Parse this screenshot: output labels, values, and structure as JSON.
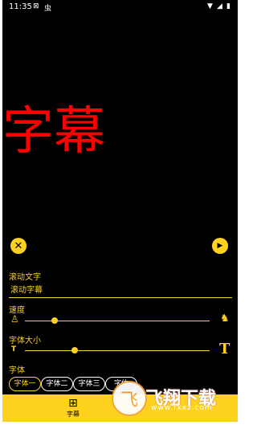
{
  "status": {
    "time": "11:35",
    "icons": [
      "notification-icon",
      "bug-icon",
      "wifi-icon",
      "signal-icon",
      "battery-icon"
    ]
  },
  "preview": {
    "text": "字幕",
    "color": "#ff0000"
  },
  "controls": {
    "text_label": "滚动文字",
    "text_value": "滚动字幕",
    "speed_label": "速度",
    "speed_value": 0.16,
    "size_label": "字体大小",
    "size_value": 0.27,
    "size_min_icon": "T",
    "size_max_icon": "T",
    "font_label": "字体",
    "fonts": [
      "字体一",
      "字体二",
      "字体三",
      "字体"
    ]
  },
  "tabbar": {
    "tab_label": "字幕",
    "tab_icon": "⊞"
  },
  "watermark": {
    "glyph": "飞",
    "text": "飞翔下载",
    "sub": "www.fxxz.com"
  },
  "colors": {
    "accent": "#ffd21f",
    "background": "#000000",
    "preview": "#ff0000"
  }
}
